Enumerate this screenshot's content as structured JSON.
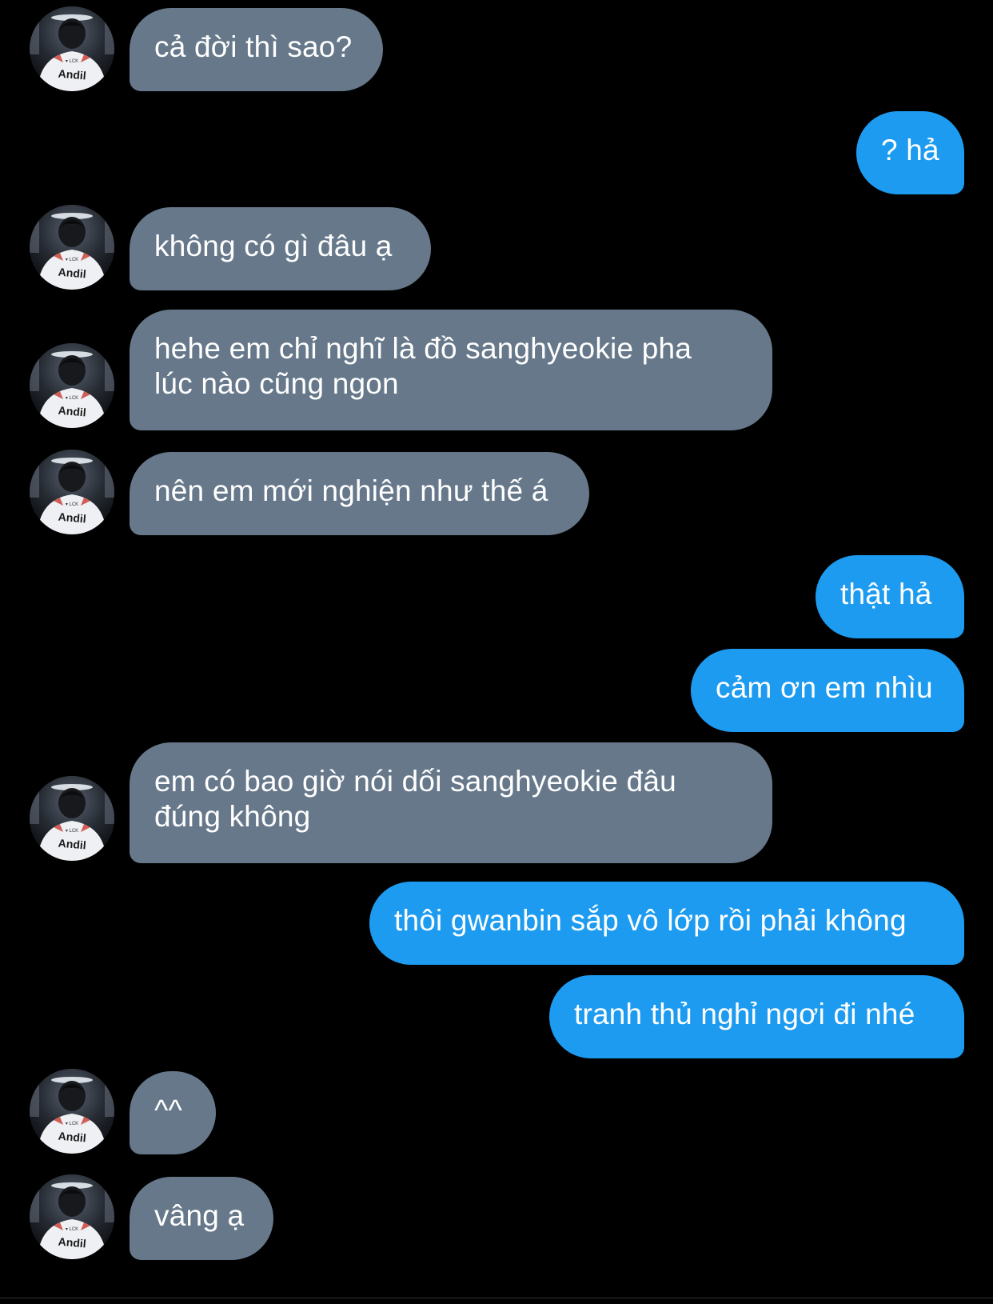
{
  "conversation": {
    "contact": {
      "avatar_icon": "profile-photo-icon",
      "avatar_shirt_text": "Andil"
    },
    "colors": {
      "incoming_bubble": "#66788a",
      "outgoing_bubble": "#1d9bf0",
      "background": "#000000"
    },
    "messages": [
      {
        "direction": "in",
        "text": "cả đời thì sao?"
      },
      {
        "direction": "out",
        "text": "? hả"
      },
      {
        "direction": "in",
        "text": "không có gì đâu ạ"
      },
      {
        "direction": "in",
        "text": "hehe em chỉ nghĩ là đồ sanghyeokie pha\nlúc nào cũng ngon"
      },
      {
        "direction": "in",
        "text": "nên em mới nghiện như thế á"
      },
      {
        "direction": "out",
        "text": "thật hả"
      },
      {
        "direction": "out",
        "text": "cảm ơn em nhìu"
      },
      {
        "direction": "in",
        "text": "em có bao giờ nói dối sanghyeokie đâu\nđúng không"
      },
      {
        "direction": "out",
        "text": "thôi gwanbin sắp vô lớp rồi phải không"
      },
      {
        "direction": "out",
        "text": "tranh thủ nghỉ ngơi đi nhé"
      },
      {
        "direction": "in",
        "text": "^^"
      },
      {
        "direction": "in",
        "text": "vâng ạ"
      }
    ]
  }
}
